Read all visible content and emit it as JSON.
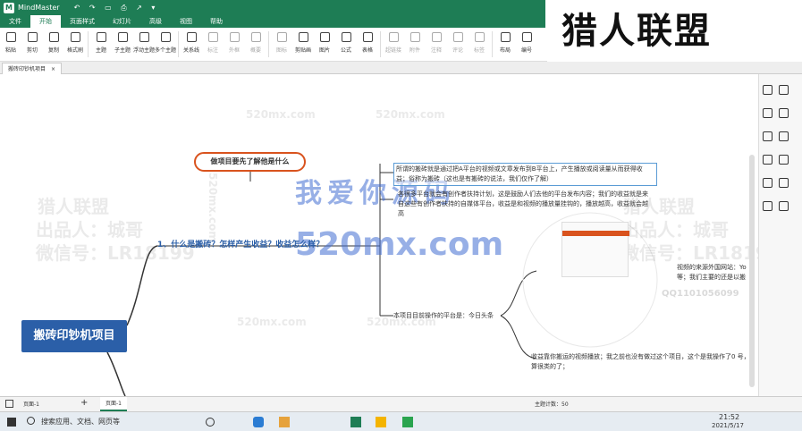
{
  "window": {
    "app_logo": "M",
    "title": "MindMaster",
    "quick_access": "↶ ↷ ▭ ⎙ ↗ ▾"
  },
  "menu": {
    "tabs": [
      "文件",
      "开始",
      "页面样式",
      "幻灯片",
      "高级",
      "视图",
      "帮助"
    ],
    "active": "开始"
  },
  "ribbon": {
    "buttons": [
      {
        "label": "粘贴",
        "icon": "clipboard-icon"
      },
      {
        "label": "剪切",
        "icon": "scissors-icon"
      },
      {
        "label": "复制",
        "icon": "copy-icon"
      },
      {
        "label": "格式刷",
        "icon": "format-painter-icon"
      },
      {
        "label": "主题",
        "icon": "topic-icon"
      },
      {
        "label": "子主题",
        "icon": "subtopic-icon"
      },
      {
        "label": "浮动主题",
        "icon": "floating-topic-icon"
      },
      {
        "label": "多个主题",
        "icon": "multiple-topics-icon"
      },
      {
        "label": "关系线",
        "icon": "relationship-icon"
      },
      {
        "label": "标注",
        "icon": "callout-icon"
      },
      {
        "label": "外框",
        "icon": "boundary-icon"
      },
      {
        "label": "概要",
        "icon": "summary-icon"
      },
      {
        "label": "图标",
        "icon": "mark-icon"
      },
      {
        "label": "剪贴画",
        "icon": "clipart-icon"
      },
      {
        "label": "图片",
        "icon": "picture-icon"
      },
      {
        "label": "公式",
        "icon": "formula-icon"
      },
      {
        "label": "表格",
        "icon": "table-icon"
      },
      {
        "label": "超链接",
        "icon": "hyperlink-icon"
      },
      {
        "label": "附件",
        "icon": "attachment-icon"
      },
      {
        "label": "注释",
        "icon": "note-icon"
      },
      {
        "label": "评论",
        "icon": "comment-icon"
      },
      {
        "label": "标签",
        "icon": "tag-icon"
      },
      {
        "label": "布局",
        "icon": "layout-icon"
      },
      {
        "label": "编号",
        "icon": "numbering-icon"
      }
    ]
  },
  "doc_tab": {
    "label": "搬砖印钞机项目",
    "close": "×"
  },
  "watermarks": {
    "brand_logo": "猎人联盟",
    "left": [
      "猎人联盟",
      "出品人：城哥",
      "微信号：LR18199"
    ],
    "right": [
      "猎人联盟",
      "出品人：城哥",
      "微信号：LR181999"
    ],
    "blue_cn": "我爱你源码",
    "blue_url": "520mx.com",
    "small_urls": [
      "520mx.com",
      "520mx.com",
      "520mx.com",
      "520mx.com",
      "520mx.com"
    ],
    "qq": "QQ1101056099"
  },
  "mindmap": {
    "root": "搬砖印钞机项目",
    "subtopic": "做项目要先了解他是什么",
    "main_topic": "1、什么是搬砖？怎样产生收益？收益怎么样？",
    "notes": [
      "所谓的搬砖就是通过把A平台的视频或文章发布到B平台上，产生播放或阅读量从而获得收益；俗称为搬砖（这也是有搬砖的说法，我们仅作了解）",
      "各很多平台就会有创作者扶持计划，这是鼓励人们去他的平台发布内容；我们的收益就是来自这些有创作者扶持的自媒体平台，收益是和视频的播放量挂钩的，播放越高，收益就会越高",
      "本项目目前操作的平台是：今日头条",
      "视频的来源外国网站：Yo 等；我们主要的还是以搬",
      "收益靠你搬运的视频播放；我之前也没有做过这个项目，这个是我操作了0 号，算很类的了；"
    ]
  },
  "status": {
    "page_selector": "页面-1",
    "page_tab": "页面-1",
    "topic_count": "主题计数：50"
  },
  "taskbar": {
    "search_placeholder": "搜索应用、文档、网页等",
    "time": "21:52",
    "date": "2021/5/17"
  },
  "colors": {
    "titlebar": "#1e7d55",
    "root_fill": "#2b5fa8",
    "subtopic_border": "#d9531e",
    "branch": "#333333"
  }
}
